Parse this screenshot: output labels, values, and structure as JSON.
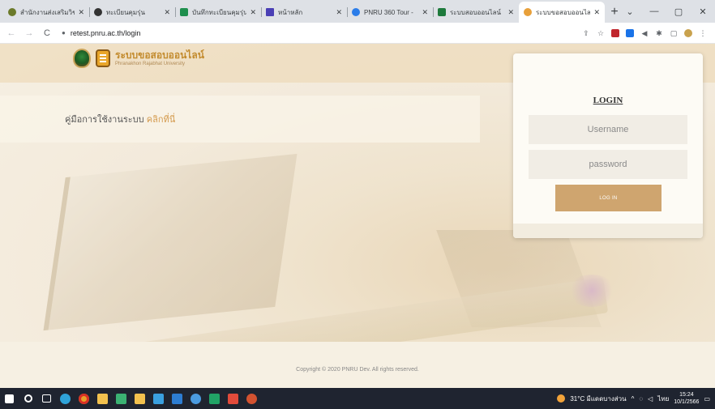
{
  "browser": {
    "tabs": [
      {
        "title": "สำนักงานส่งเสริมวิชาการ",
        "favicon_color": "#6b7a2a"
      },
      {
        "title": "ทะเบียนคุมรุ่น",
        "favicon_color": "#333333"
      },
      {
        "title": "บันทึกทะเบียนคุมรุ่น",
        "favicon_color": "#1f8f4e"
      },
      {
        "title": "หน้าหลัก",
        "favicon_color": "#4a3fb5"
      },
      {
        "title": "PNRU 360 Tour -",
        "favicon_color": "#2b7de9"
      },
      {
        "title": "ระบบสอบออนไลน์",
        "favicon_color": "#1e7a3c"
      },
      {
        "title": "ระบบขอสอบออนไลน์",
        "favicon_color": "#e8a03a",
        "active": true
      }
    ],
    "new_tab": "+",
    "window_controls": [
      "⌄",
      "—",
      "▢",
      "✕"
    ],
    "url": "retest.pnru.ac.th/login"
  },
  "header": {
    "brand_title": "ระบบขอสอบออนไลน์",
    "brand_subtitle": "Phranakhon Rajabhat University"
  },
  "manual": {
    "text": "คู่มือการใช้งานระบบ",
    "link": "คลิกที่นี่"
  },
  "login": {
    "title": "LOGIN",
    "username_placeholder": "Username",
    "password_placeholder": "password",
    "button": "LOG IN"
  },
  "footer": {
    "copyright": "Copyright © 2020 PNRU Dev. All rights reserved."
  },
  "taskbar": {
    "weather": "31°C มีแดดบางส่วน",
    "language": "ไทย",
    "time": "15:24",
    "date": "10/1/2566"
  }
}
